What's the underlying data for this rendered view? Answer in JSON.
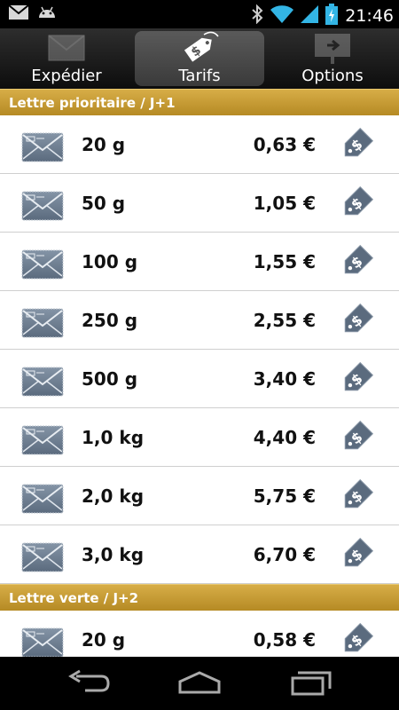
{
  "status_bar": {
    "time": "21:46",
    "icons": [
      "gmail-icon",
      "android-icon",
      "bluetooth-icon",
      "wifi-icon",
      "signal-icon",
      "battery-charging-icon"
    ]
  },
  "tabs": [
    {
      "label": "Expédier",
      "icon": "envelope-icon",
      "active": false
    },
    {
      "label": "Tarifs",
      "icon": "price-tag-icon",
      "active": true
    },
    {
      "label": "Options",
      "icon": "sign-arrow-icon",
      "active": false
    }
  ],
  "sections": [
    {
      "title": "Lettre prioritaire / J+1",
      "rows": [
        {
          "weight": "20 g",
          "price": "0,63 €"
        },
        {
          "weight": "50 g",
          "price": "1,05 €"
        },
        {
          "weight": "100 g",
          "price": "1,55 €"
        },
        {
          "weight": "250 g",
          "price": "2,55 €"
        },
        {
          "weight": "500 g",
          "price": "3,40 €"
        },
        {
          "weight": "1,0 kg",
          "price": "4,40 €"
        },
        {
          "weight": "2,0 kg",
          "price": "5,75 €"
        },
        {
          "weight": "3,0 kg",
          "price": "6,70 €"
        }
      ]
    },
    {
      "title": "Lettre verte / J+2",
      "rows": [
        {
          "weight": "20 g",
          "price": "0,58 €"
        }
      ]
    }
  ],
  "nav": [
    "back-icon",
    "home-icon",
    "recent-apps-icon"
  ],
  "colors": {
    "section_header": "#c89a32",
    "tag": "#5b6b7e",
    "envelope": "#6f7f92"
  }
}
